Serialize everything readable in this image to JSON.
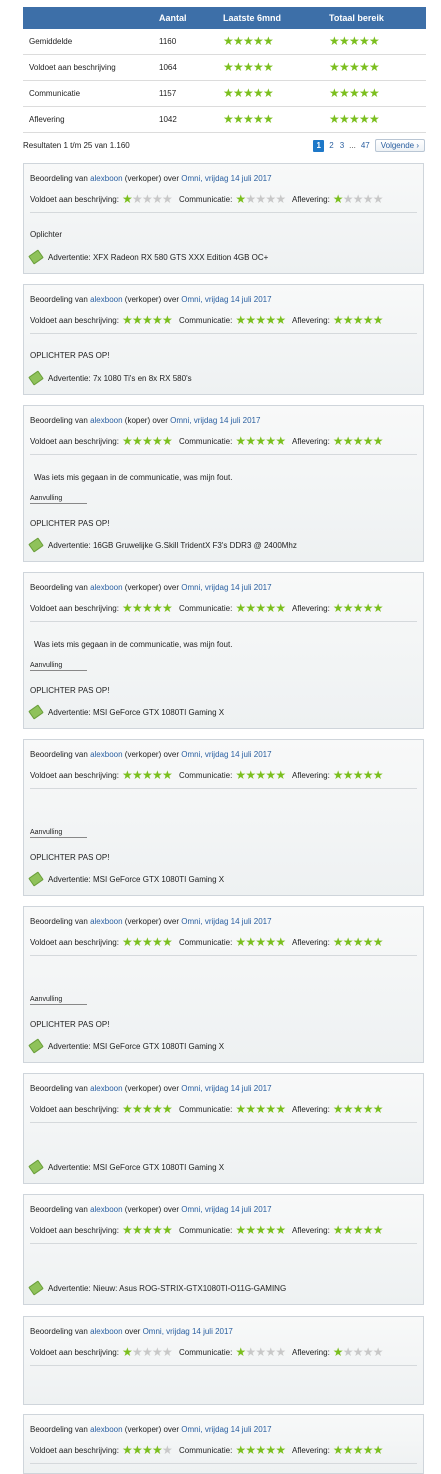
{
  "stats": {
    "headers": [
      "",
      "Aantal",
      "Laatste 6mnd",
      "Totaal bereik"
    ],
    "rows": [
      {
        "label": "Gemiddelde",
        "count": "1160",
        "last6": 5,
        "total": 5
      },
      {
        "label": "Voldoet aan beschrijving",
        "count": "1064",
        "last6": 5,
        "total": 5
      },
      {
        "label": "Communicatie",
        "count": "1157",
        "last6": 5,
        "total": 5
      },
      {
        "label": "Aflevering",
        "count": "1042",
        "last6": 5,
        "total": 5
      }
    ]
  },
  "pagination": {
    "info": "Resultaten 1 t/m 25 van 1.160",
    "current": "1",
    "pages": [
      "2",
      "3"
    ],
    "dots": "...",
    "last": "47",
    "next": "Volgende"
  },
  "labels": {
    "prefix": "Beoordeling van",
    "over": "over",
    "description": "Voldoet aan beschrijving:",
    "communication": "Communicatie:",
    "delivery": "Aflevering:",
    "addition": "Aanvulling",
    "advert_prefix": "Advertentie:"
  },
  "colors": {
    "star_on": "#7bbf1e",
    "star_off": "#c8c8c8",
    "header_bg": "#3d6fa8",
    "page_current": "#1e78c8"
  },
  "reviews": [
    {
      "user": "alexboon",
      "role": "(verkoper)",
      "shop": "Omni,",
      "date": "vrijdag 14 juli 2017",
      "desc": 1,
      "comm": 1,
      "deliv": 1,
      "comment": "Oplichter",
      "addition": false,
      "reply": "",
      "advert": "XFX Radeon RX 580 GTS XXX Edition 4GB OC+"
    },
    {
      "user": "alexboon",
      "role": "(verkoper)",
      "shop": "Omni,",
      "date": "vrijdag 14 juli 2017",
      "desc": 5,
      "comm": 5,
      "deliv": 5,
      "comment": "OPLICHTER PAS OP!",
      "addition": false,
      "reply": "",
      "advert": "7x 1080 Ti's en 8x RX 580's"
    },
    {
      "user": "alexboon",
      "role": "(koper)",
      "shop": "Omni,",
      "date": "vrijdag 14 juli 2017",
      "desc": 5,
      "comm": 5,
      "deliv": 5,
      "comment": "Was iets mis gegaan in de communicatie, was mijn fout.",
      "addition": true,
      "reply": "OPLICHTER PAS OP!",
      "advert": "16GB Gruwelijke G.Skill TridentX F3's DDR3 @ 2400Mhz"
    },
    {
      "user": "alexboon",
      "role": "(verkoper)",
      "shop": "Omni,",
      "date": "vrijdag 14 juli 2017",
      "desc": 5,
      "comm": 5,
      "deliv": 5,
      "comment": "Was iets mis gegaan in de communicatie, was mijn fout.",
      "addition": true,
      "reply": "OPLICHTER PAS OP!",
      "advert": "MSI GeForce GTX 1080TI Gaming X"
    },
    {
      "user": "alexboon",
      "role": "(verkoper)",
      "shop": "Omni,",
      "date": "vrijdag 14 juli 2017",
      "desc": 5,
      "comm": 5,
      "deliv": 5,
      "comment": "",
      "addition": true,
      "reply": "OPLICHTER PAS OP!",
      "advert": "MSI GeForce GTX 1080TI Gaming X"
    },
    {
      "user": "alexboon",
      "role": "(verkoper)",
      "shop": "Omni,",
      "date": "vrijdag 14 juli 2017",
      "desc": 5,
      "comm": 5,
      "deliv": 5,
      "comment": "",
      "addition": true,
      "reply": "OPLICHTER PAS OP!",
      "advert": "MSI GeForce GTX 1080TI Gaming X"
    },
    {
      "user": "alexboon",
      "role": "(verkoper)",
      "shop": "Omni,",
      "date": "vrijdag 14 juli 2017",
      "desc": 5,
      "comm": 5,
      "deliv": 5,
      "comment": "",
      "addition": false,
      "reply": "",
      "advert": "MSI GeForce GTX 1080TI Gaming X"
    },
    {
      "user": "alexboon",
      "role": "(verkoper)",
      "shop": "Omni,",
      "date": "vrijdag 14 juli 2017",
      "desc": 5,
      "comm": 5,
      "deliv": 5,
      "comment": "",
      "addition": false,
      "reply": "",
      "advert": "Nieuw: Asus ROG-STRIX-GTX1080TI-O11G-GAMING"
    },
    {
      "user": "alexboon",
      "role": "",
      "shop": "Omni,",
      "date": "vrijdag 14 juli 2017",
      "desc": 1,
      "comm": 1,
      "deliv": 1,
      "comment": "",
      "addition": false,
      "reply": "",
      "advert": ""
    },
    {
      "user": "alexboon",
      "role": "(verkoper)",
      "shop": "Omni,",
      "date": "vrijdag 14 juli 2017",
      "desc": 4,
      "comm": 5,
      "deliv": 5,
      "comment": "",
      "addition": false,
      "reply": "",
      "advert": ""
    }
  ]
}
